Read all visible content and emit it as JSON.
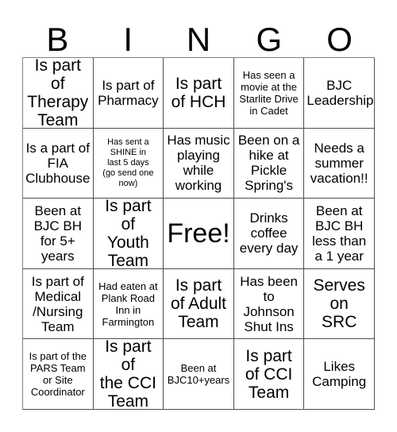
{
  "header": {
    "letters": [
      "B",
      "I",
      "N",
      "G",
      "O"
    ]
  },
  "grid": {
    "rows": 5,
    "columns": 5,
    "cells": [
      {
        "text": "Is part of\nTherapy\nTeam",
        "size": "lg"
      },
      {
        "text": "Is part of\nPharmacy",
        "size": "md"
      },
      {
        "text": "Is part\nof HCH",
        "size": "lg"
      },
      {
        "text": "Has seen a\nmovie at the\nStarlite Drive\nin Cadet",
        "size": "sm"
      },
      {
        "text": "BJC\nLeadership",
        "size": "md"
      },
      {
        "text": "Is a part of\nFIA\nClubhouse",
        "size": "md"
      },
      {
        "text": "Has sent a\nSHINE in\nlast 5 days\n(go send one\nnow)",
        "size": "xs"
      },
      {
        "text": "Has music\nplaying\nwhile\nworking",
        "size": "md"
      },
      {
        "text": "Been on a\nhike at\nPickle\nSpring's",
        "size": "md"
      },
      {
        "text": "Needs a\nsummer\nvacation!!",
        "size": "md"
      },
      {
        "text": "Been at\nBJC BH\nfor 5+\nyears",
        "size": "md"
      },
      {
        "text": "Is part of\nYouth\nTeam",
        "size": "lg"
      },
      {
        "text": "Free!",
        "size": "xl"
      },
      {
        "text": "Drinks\ncoffee\nevery day",
        "size": "md"
      },
      {
        "text": "Been at\nBJC BH\nless than\na 1 year",
        "size": "md"
      },
      {
        "text": "Is part of\nMedical\n/Nursing\nTeam",
        "size": "md"
      },
      {
        "text": "Had eaten at\nPlank Road\nInn in\nFarmington",
        "size": "sm"
      },
      {
        "text": "Is part\nof Adult\nTeam",
        "size": "lg"
      },
      {
        "text": "Has been\nto\nJohnson\nShut Ins",
        "size": "md"
      },
      {
        "text": "Serves\non\nSRC",
        "size": "lg"
      },
      {
        "text": "Is part of the\nPARS Team\nor Site\nCoordinator",
        "size": "sm"
      },
      {
        "text": "Is part of\nthe CCI\nTeam",
        "size": "lg"
      },
      {
        "text": "Been at\nBJC10+years",
        "size": "sm"
      },
      {
        "text": "Is part\nof CCI\nTeam",
        "size": "lg"
      },
      {
        "text": "Likes\nCamping",
        "size": "md"
      }
    ]
  },
  "colors": {
    "background": "#ffffff",
    "text": "#000000",
    "grid_line": "#4d4d4d"
  }
}
